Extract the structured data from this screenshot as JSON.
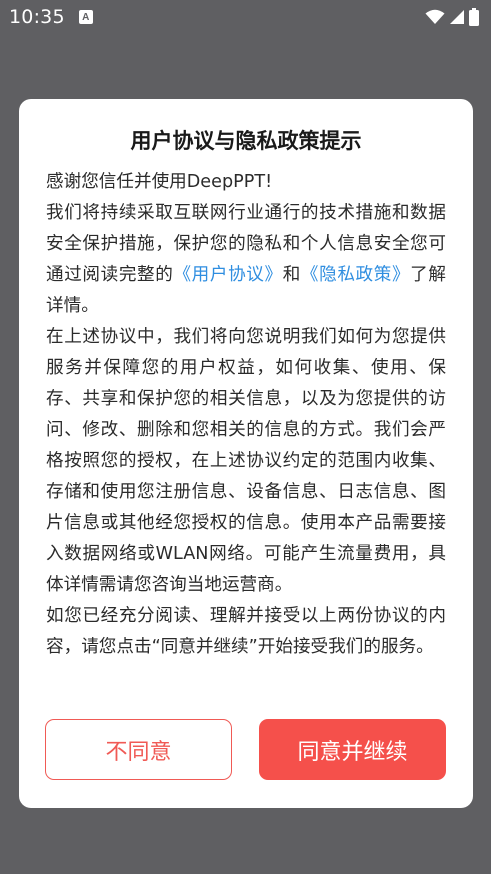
{
  "status_bar": {
    "time": "10:35",
    "notification_icon": "A"
  },
  "dialog": {
    "title": "用户协议与隐私政策提示",
    "greeting": "感谢您信任并使用DeepPPT!",
    "para1_a": "我们将持续采取互联网行业通行的技术措施和数据安全保护措施，保护您的隐私和个人信息安全您可通过阅读完整的",
    "user_agreement_link": "《用户协议》",
    "and": "和",
    "privacy_policy_link": "《隐私政策》",
    "para1_b": "了解详情。",
    "para2": "在上述协议中，我们将向您说明我们如何为您提供服务并保障您的用户权益，如何收集、使用、保存、共享和保护您的相关信息，以及为您提供的访问、修改、删除和您相关的信息的方式。我们会严格按照您的授权，在上述协议约定的范围内收集、存储和使用您注册信息、设备信息、日志信息、图片信息或其他经您授权的信息。使用本产品需要接入数据网络或WLAN网络。可能产生流量费用，具体详情需请您咨询当地运营商。",
    "para3": "如您已经充分阅读、理解并接受以上两份协议的内容，请您点击“同意并继续”开始接受我们的服务。",
    "disagree_label": "不同意",
    "agree_label": "同意并继续"
  },
  "colors": {
    "accent": "#f5504b",
    "link": "#2f8ee0",
    "overlay": "#5f5f62"
  }
}
